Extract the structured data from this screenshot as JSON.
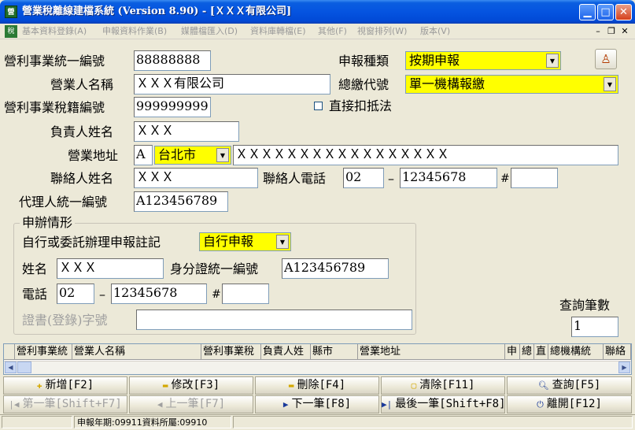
{
  "window": {
    "title": "營業稅離線建檔系統 (Version 8.90) - [ＸＸＸ有限公司]",
    "app_icon_text": "營"
  },
  "menu": [
    "基本資料登錄(A)",
    "申報資料作業(B)",
    "媒體檔匯入(D)",
    "資料庫轉檔(E)",
    "其他(F)",
    "視窗排列(W)",
    "版本(V)"
  ],
  "form": {
    "tax_id_label": "營利事業統一編號",
    "tax_id_value": "88888888",
    "name_label": "營業人名稱",
    "name_value": "ＸＸＸ有限公司",
    "reg_no_label": "營利事業稅籍編號",
    "reg_no_value": "999999999",
    "owner_label": "負責人姓名",
    "owner_value": "ＸＸＸ",
    "address_label": "營業地址",
    "address_prefix": "A",
    "address_city": "台北市",
    "address_value": "ＸＸＸＸＸＸＸＸＸＸＸＸＸＸＸＸＸ",
    "contact_label": "聯絡人姓名",
    "contact_value": "ＸＸＸ",
    "contact_phone_label": "聯絡人電話",
    "contact_phone_area": "02",
    "contact_phone_dash": "–",
    "contact_phone_number": "12345678",
    "contact_phone_hash": "#",
    "contact_phone_ext": "",
    "agent_id_label": "代理人統一編號",
    "agent_id_value": "A123456789",
    "filing_type_label": "申報種類",
    "filing_type_value": "按期申報",
    "payment_code_label": "總繳代號",
    "payment_code_value": "單一機構報繳",
    "direct_deduct_label": "直接扣抵法",
    "direct_deduct_checked": false
  },
  "filing": {
    "group_title": "申辦情形",
    "mode_label": "自行或委託辦理申報註記",
    "mode_value": "自行申報",
    "name_label": "姓名",
    "name_value": "ＸＸＸ",
    "id_label": "身分證統一編號",
    "id_value": "A123456789",
    "phone_label": "電話",
    "phone_area": "02",
    "phone_dash": "–",
    "phone_number": "12345678",
    "phone_hash": "#",
    "phone_ext": "",
    "cert_label": "證書(登錄)字號",
    "cert_value": ""
  },
  "query": {
    "count_label": "查詢筆數",
    "count_value": "1"
  },
  "grid": {
    "columns": [
      "營利事業統",
      "營業人名稱",
      "營利事業稅",
      "負責人姓",
      "縣市",
      "營業地址",
      "申",
      "總",
      "直",
      "總機構統",
      "聯絡"
    ]
  },
  "buttons": {
    "add": "新增[F2]",
    "edit": "修改[F3]",
    "delete": "刪除[F4]",
    "clear": "清除[F11]",
    "search": "查詢[F5]",
    "first": "第一筆[Shift+F7]",
    "prev": "上一筆[F7]",
    "next": "下一筆[F8]",
    "last": "最後一筆[Shift+F8]",
    "exit": "離開[F12]"
  },
  "status": {
    "text": "申報年期:09911資料所屬:09910"
  },
  "colors": {
    "title_bar": "#0554e0",
    "highlight": "#ffff00",
    "window_bg": "#ece9d8"
  }
}
